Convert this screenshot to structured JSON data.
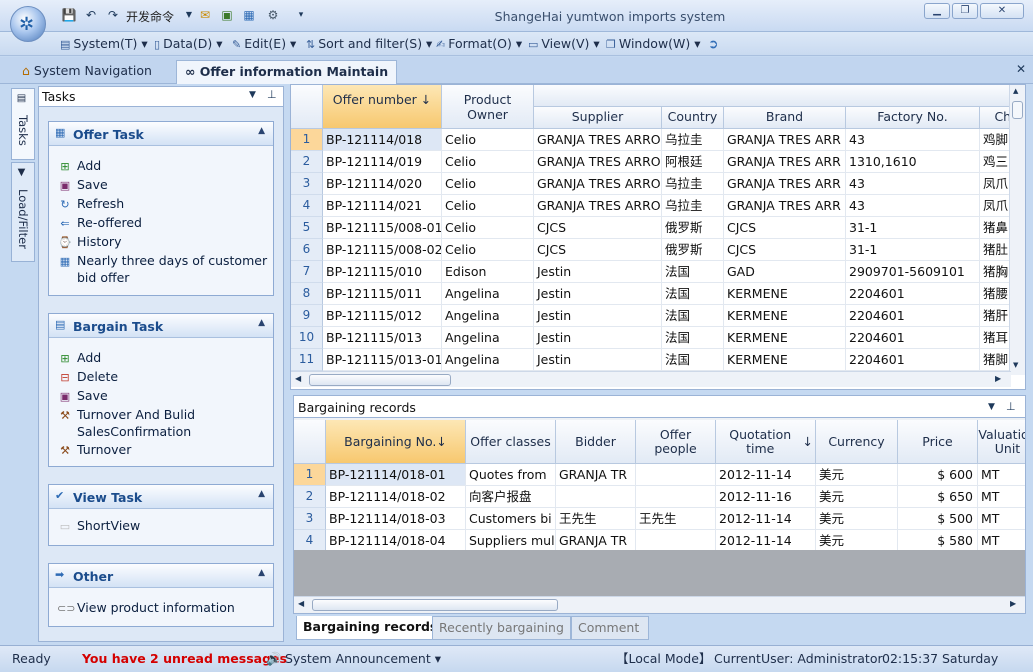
{
  "window": {
    "title": "ShangeHai yumtwon imports system",
    "quick_access_label": "开发命令",
    "quick_access_icons": [
      "save-icon",
      "undo-icon",
      "redo-icon",
      "mail-icon",
      "clipboard-icon",
      "calendar-icon",
      "settings-icon",
      "dropdown-icon"
    ],
    "controls": [
      "minimize",
      "maximize",
      "close"
    ]
  },
  "menu": [
    {
      "label": "System(T)",
      "icon": "system-icon"
    },
    {
      "label": "Data(D)",
      "icon": "data-icon"
    },
    {
      "label": "Edit(E)",
      "icon": "edit-icon"
    },
    {
      "label": "Sort and filter(S)",
      "icon": "sort-icon"
    },
    {
      "label": "Format(O)",
      "icon": "format-icon"
    },
    {
      "label": "View(V)",
      "icon": "view-icon"
    },
    {
      "label": "Window(W)",
      "icon": "window-icon"
    }
  ],
  "doc_tabs": [
    {
      "label": "System Navigation",
      "active": false
    },
    {
      "label": "Offer information Maintain",
      "active": true
    }
  ],
  "side_tabs": [
    "Tasks",
    "Load/Filter"
  ],
  "task_panel": {
    "title": "Tasks",
    "groups": [
      {
        "title": "Offer Task",
        "items": [
          {
            "label": "Add",
            "icon": "add-icon"
          },
          {
            "label": "Save",
            "icon": "save-icon"
          },
          {
            "label": "Refresh",
            "icon": "refresh-icon"
          },
          {
            "label": "Re-offered",
            "icon": "reoffer-icon"
          },
          {
            "label": "History",
            "icon": "history-icon"
          },
          {
            "label": "Nearly three days of customer",
            "label2": "bid offer",
            "icon": "table-icon"
          }
        ]
      },
      {
        "title": "Bargain Task",
        "items": [
          {
            "label": "Add",
            "icon": "add-icon"
          },
          {
            "label": "Delete",
            "icon": "delete-icon"
          },
          {
            "label": "Save",
            "icon": "save-icon"
          },
          {
            "label": "Turnover And Bulid",
            "label2": "SalesConfirmation",
            "icon": "gavel-icon"
          },
          {
            "label": "Turnover",
            "icon": "gavel-icon"
          }
        ]
      },
      {
        "title": "View Task",
        "items": [
          {
            "label": "ShortView",
            "icon": "shortview-icon"
          }
        ]
      },
      {
        "title": "Other",
        "items": [
          {
            "label": "View product information",
            "icon": "link-icon"
          }
        ]
      }
    ]
  },
  "offer_grid": {
    "columns": [
      "Offer number",
      "Product Owner",
      "Supplier",
      "Country",
      "Brand",
      "Factory No.",
      "Chi"
    ],
    "rows": [
      [
        "1",
        "BP-121114/018",
        "Celio",
        "GRANJA TRES ARRO",
        "乌拉圭",
        "GRANJA TRES ARR",
        "43",
        "鸡脚"
      ],
      [
        "2",
        "BP-121114/019",
        "Celio",
        "GRANJA TRES ARRO",
        "阿根廷",
        "GRANJA TRES ARR",
        "1310,1610",
        "鸡三"
      ],
      [
        "3",
        "BP-121114/020",
        "Celio",
        "GRANJA TRES ARRO",
        "乌拉圭",
        "GRANJA TRES ARR",
        "43",
        "凤爪"
      ],
      [
        "4",
        "BP-121114/021",
        "Celio",
        "GRANJA TRES ARRO",
        "乌拉圭",
        "GRANJA TRES ARR",
        "43",
        "凤爪"
      ],
      [
        "5",
        "BP-121115/008-01",
        "Celio",
        "CJCS",
        "俄罗斯",
        "CJCS",
        "31-1",
        "猪鼻"
      ],
      [
        "6",
        "BP-121115/008-02",
        "Celio",
        "CJCS",
        "俄罗斯",
        "CJCS",
        "31-1",
        "猪肚"
      ],
      [
        "7",
        "BP-121115/010",
        "Edison",
        "Jestin",
        "法国",
        "GAD",
        "2909701-5609101",
        "猪胸"
      ],
      [
        "8",
        "BP-121115/011",
        "Angelina",
        "Jestin",
        "法国",
        "KERMENE",
        "2204601",
        "猪腰"
      ],
      [
        "9",
        "BP-121115/012",
        "Angelina",
        "Jestin",
        "法国",
        "KERMENE",
        "2204601",
        "猪肝"
      ],
      [
        "10",
        "BP-121115/013",
        "Angelina",
        "Jestin",
        "法国",
        "KERMENE",
        "2204601",
        "猪耳"
      ],
      [
        "11",
        "BP-121115/013-01",
        "Angelina",
        "Jestin",
        "法国",
        "KERMENE",
        "2204601",
        "猪脚"
      ]
    ]
  },
  "bargain_panel": {
    "title": "Bargaining records",
    "columns": [
      "Bargaining No.",
      "Offer classes",
      "Bidder",
      "Offer people",
      "Quotation time",
      "Currency",
      "Price",
      "Valuation Unit"
    ],
    "rows": [
      [
        "1",
        "BP-121114/018-01",
        "Quotes from",
        "GRANJA TR",
        "",
        "2012-11-14",
        "美元",
        "$ 600",
        "MT"
      ],
      [
        "2",
        "BP-121114/018-02",
        "向客户报盘",
        "",
        "",
        "2012-11-16",
        "美元",
        "$ 650",
        "MT"
      ],
      [
        "3",
        "BP-121114/018-03",
        "Customers bi",
        "王先生",
        "王先生",
        "2012-11-14",
        "美元",
        "$ 500",
        "MT"
      ],
      [
        "4",
        "BP-121114/018-04",
        "Suppliers mul",
        "GRANJA TR",
        "",
        "2012-11-14",
        "美元",
        "$ 580",
        "MT"
      ]
    ]
  },
  "bottom_tabs": [
    {
      "label": "Bargaining records",
      "active": true
    },
    {
      "label": "Recently bargaining",
      "active": false
    },
    {
      "label": "Comment",
      "active": false
    }
  ],
  "status": {
    "ready": "Ready",
    "messages": "You have 2 unread messages",
    "announcement": "System Announcement",
    "mode": "【Local Mode】",
    "user": "CurrentUser: Administrator",
    "time": "02:15:37",
    "day": "Saturday",
    "colors": {
      "alert": "#d40000",
      "accent": "#1b4c8c"
    }
  }
}
